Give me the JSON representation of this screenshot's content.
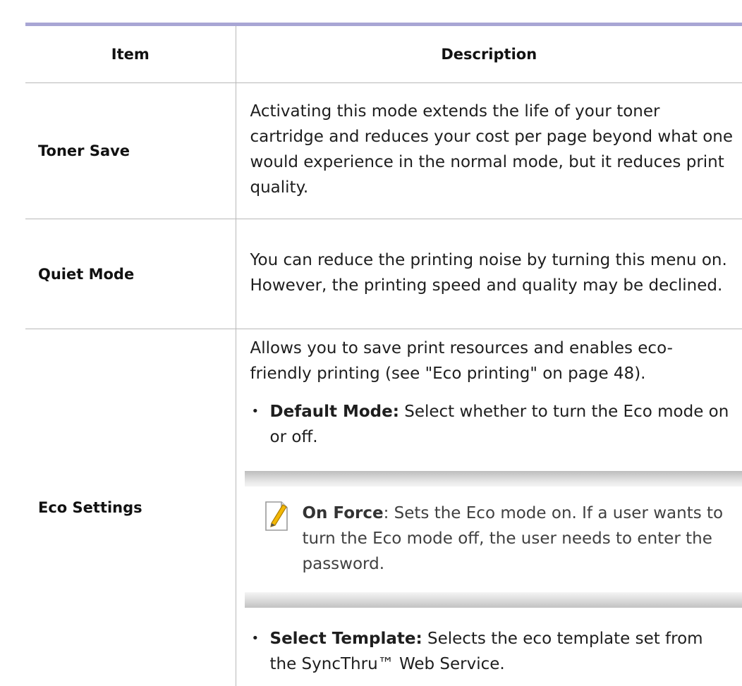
{
  "table": {
    "header": {
      "item": "Item",
      "description": "Description"
    },
    "rows": [
      {
        "item": "Toner Save",
        "description": "Activating this mode extends the life of your toner cartridge and reduces your cost per page beyond what one would experience in the normal mode, but it reduces print quality."
      },
      {
        "item": "Quiet Mode",
        "description": "You can reduce the printing noise by turning this menu on. However, the printing speed and quality may be declined."
      },
      {
        "item": "Eco Settings",
        "intro": "Allows you to save print resources and enables eco-friendly printing (see \"Eco printing\" on page 48).",
        "bullets": [
          {
            "label": "Default Mode:",
            "text": " Select whether to turn the Eco mode on or off."
          },
          {
            "label": "Select Template:",
            "text": " Selects the eco template set from the SyncThru™ Web Service."
          }
        ],
        "note": {
          "icon": "note-pencil-icon",
          "label": "On Force",
          "text": ": Sets the Eco mode on. If a user wants to turn the Eco mode off, the user needs to enter the password."
        }
      }
    ]
  },
  "colors": {
    "top_rule": "#a8a6d4",
    "border": "#b8b8b8",
    "note_pencil": "#f2b705"
  }
}
